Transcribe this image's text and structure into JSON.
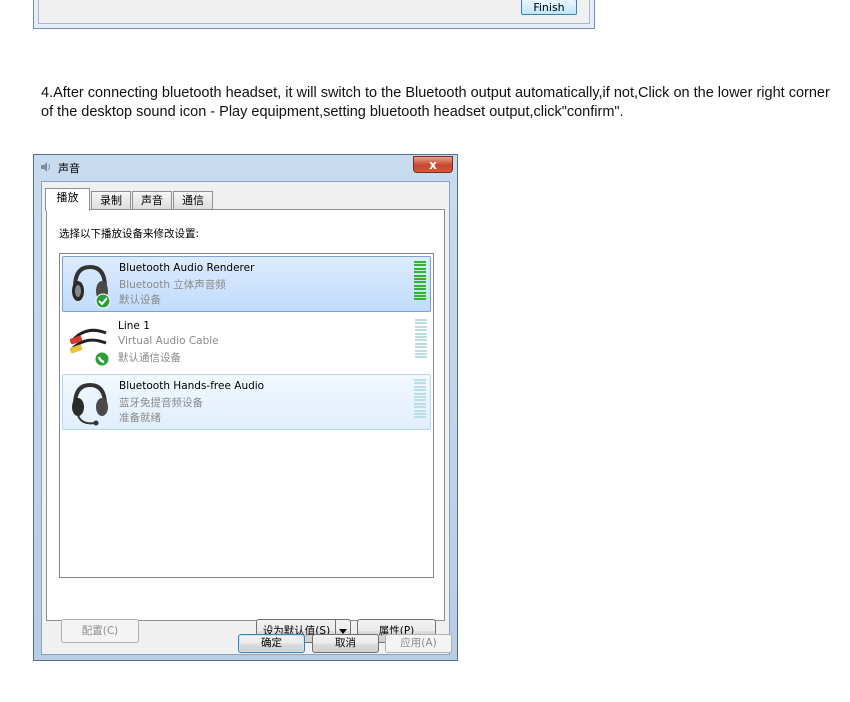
{
  "top_dialog": {
    "finish_label": "Finish"
  },
  "instruction": "4.After connecting bluetooth headset, it will switch to the Bluetooth output automatically,if not,Click on the lower right corner of the desktop sound icon - Play equipment,setting bluetooth headset output,click\"confirm\".",
  "window": {
    "title": "声音",
    "close_label": "x",
    "tabs": [
      {
        "label": "播放"
      },
      {
        "label": "录制"
      },
      {
        "label": "声音"
      },
      {
        "label": "通信"
      }
    ],
    "panel_instruction": "选择以下播放设备来修改设置:",
    "devices": [
      {
        "name": "Bluetooth Audio Renderer",
        "description": "Bluetooth 立体声音频",
        "status": "默认设备",
        "icon": "headphones-icon",
        "badge": "check-badge-icon",
        "state": "selected",
        "level": 1.0
      },
      {
        "name": "Line 1",
        "description": "Virtual Audio Cable",
        "status": "默认通信设备",
        "icon": "audio-cable-icon",
        "badge": "phone-badge-icon",
        "state": "normal",
        "level": 0
      },
      {
        "name": "Bluetooth Hands-free Audio",
        "description": "蓝牙免提音频设备",
        "status": "准备就绪",
        "icon": "headset-icon",
        "badge": "",
        "state": "hover",
        "level": 0
      }
    ],
    "buttons": {
      "configure": "配置(C)",
      "set_default": "设为默认值(S)",
      "properties": "属性(P)",
      "ok": "确定",
      "cancel": "取消",
      "apply": "应用(A)"
    }
  }
}
